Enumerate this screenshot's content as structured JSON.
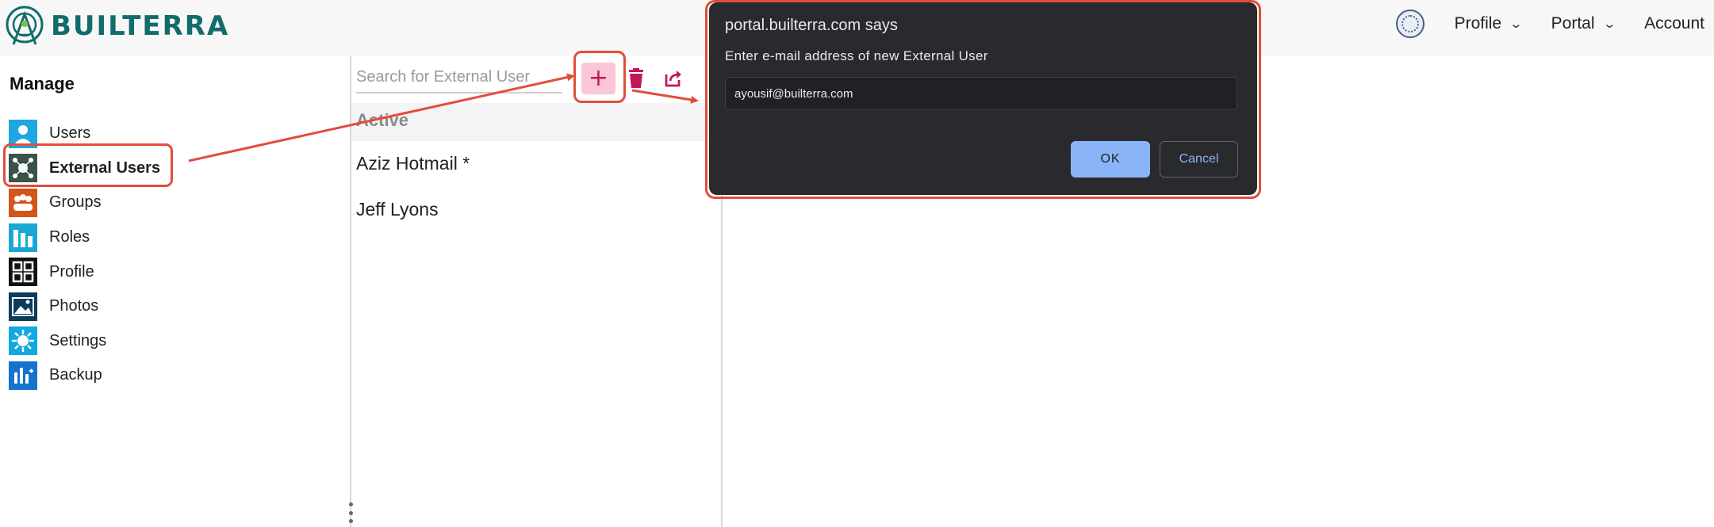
{
  "header": {
    "brand": "BUILTERRA",
    "nav": [
      {
        "label": "Profile",
        "has_dropdown": true
      },
      {
        "label": "Portal",
        "has_dropdown": true
      },
      {
        "label": "Account",
        "has_dropdown": false
      }
    ],
    "brand_color": "#136c6c"
  },
  "sidebar": {
    "title": "Manage",
    "items": [
      {
        "label": "Users",
        "icon": "users-icon",
        "color": "#1ea7e0"
      },
      {
        "label": "External Users",
        "icon": "external-users-icon",
        "color": "#3b5248",
        "active": true
      },
      {
        "label": "Groups",
        "icon": "groups-icon",
        "color": "#d4541a"
      },
      {
        "label": "Roles",
        "icon": "roles-icon",
        "color": "#1aa7d6"
      },
      {
        "label": "Profile",
        "icon": "profile-grid-icon",
        "color": "#111111"
      },
      {
        "label": "Photos",
        "icon": "photos-icon",
        "color": "#0d3b5a"
      },
      {
        "label": "Settings",
        "icon": "settings-icon",
        "color": "#12a8e0"
      },
      {
        "label": "Backup",
        "icon": "backup-icon",
        "color": "#1572cf"
      }
    ]
  },
  "list_panel": {
    "search_placeholder": "Search for External User",
    "add_label": "+",
    "section": "Active",
    "users": [
      "Aziz Hotmail *",
      "Jeff Lyons"
    ]
  },
  "dialog": {
    "title": "portal.builterra.com says",
    "message": "Enter e-mail address of new External User",
    "input_value": "ayousif@builterra.com",
    "ok_label": "OK",
    "cancel_label": "Cancel",
    "background": "#292a2d",
    "ok_color": "#8ab4f8"
  },
  "annotation_color": "#e14d3b"
}
